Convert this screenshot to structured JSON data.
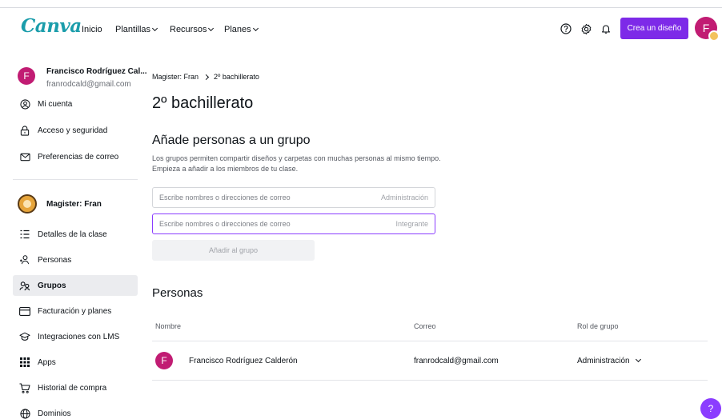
{
  "header": {
    "logo": "Canva",
    "nav": [
      {
        "label": "Inicio",
        "has_menu": false
      },
      {
        "label": "Plantillas",
        "has_menu": true
      },
      {
        "label": "Recursos",
        "has_menu": true
      },
      {
        "label": "Planes",
        "has_menu": true
      }
    ],
    "icons": [
      "help-circle-icon",
      "gear-icon",
      "bell-icon"
    ],
    "create_button": "Crea un diseño",
    "avatar_initial": "F"
  },
  "sidebar": {
    "profile": {
      "initial": "F",
      "name": "Francisco Rodríguez Cal...",
      "email": "franrodcald@gmail.com"
    },
    "account_items": [
      {
        "label": "Mi cuenta",
        "icon": "at-sign-icon"
      },
      {
        "label": "Acceso y seguridad",
        "icon": "lock-icon"
      },
      {
        "label": "Preferencias de correo",
        "icon": "mail-icon"
      }
    ],
    "team_name": "Magister: Fran",
    "team_items": [
      {
        "label": "Detalles de la clase",
        "icon": "list-icon",
        "active": false
      },
      {
        "label": "Personas",
        "icon": "add-people-icon",
        "active": false
      },
      {
        "label": "Grupos",
        "icon": "group-icon",
        "active": true
      },
      {
        "label": "Facturación y planes",
        "icon": "card-icon",
        "active": false
      },
      {
        "label": "Integraciones con LMS",
        "icon": "graduation-cap-icon",
        "active": false
      },
      {
        "label": "Apps",
        "icon": "apps-grid-icon",
        "active": false
      },
      {
        "label": "Historial de compra",
        "icon": "cart-icon",
        "active": false
      },
      {
        "label": "Dominios",
        "icon": "globe-icon",
        "active": false
      }
    ]
  },
  "main": {
    "breadcrumb": {
      "parent": "Magister: Fran",
      "current": "2º bachillerato"
    },
    "title": "2º bachillerato",
    "add_section": {
      "title": "Añade personas a un grupo",
      "description": "Los grupos permiten compartir diseños y carpetas con muchas personas al mismo tiempo. Empieza a añadir a los miembros de tu clase.",
      "admin_field": {
        "placeholder": "Escribe nombres o direcciones de correo",
        "role": "Administración"
      },
      "member_field": {
        "placeholder": "Escribe nombres o direcciones de correo",
        "role": "Integrante"
      },
      "add_button": "Añadir al grupo"
    },
    "people": {
      "title": "Personas",
      "columns": [
        "Nombre",
        "Correo",
        "Rol de grupo"
      ],
      "rows": [
        {
          "initial": "F",
          "name": "Francisco Rodríguez Calderón",
          "email": "franrodcald@gmail.com",
          "role": "Administración"
        }
      ]
    }
  },
  "help_button": "?",
  "colors": {
    "brand_purple": "#7d2ae8",
    "avatar_pink": "#c11c73",
    "logo_teal": "#1b9dab"
  }
}
